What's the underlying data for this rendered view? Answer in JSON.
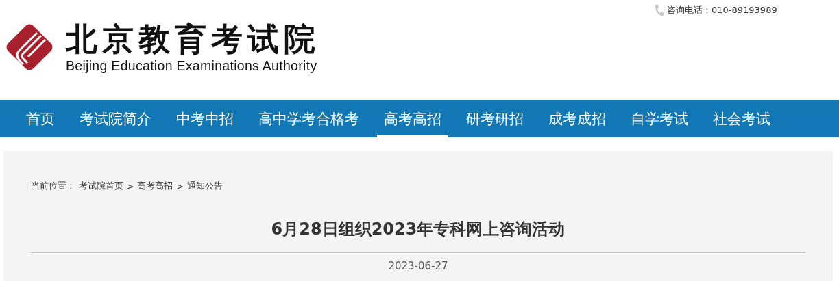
{
  "header": {
    "phone": "咨询电话：010-89193989",
    "logo_cn": "北京教育考试院",
    "logo_en": "Beijing Education Examinations Authority"
  },
  "nav": [
    {
      "label": "首页",
      "selected": false
    },
    {
      "label": "考试院简介",
      "selected": false
    },
    {
      "label": "中考中招",
      "selected": false
    },
    {
      "label": "高中学考合格考",
      "selected": false
    },
    {
      "label": "高考高招",
      "selected": true
    },
    {
      "label": "研考研招",
      "selected": false
    },
    {
      "label": "成考成招",
      "selected": false
    },
    {
      "label": "自学考试",
      "selected": false
    },
    {
      "label": "社会考试",
      "selected": false
    }
  ],
  "breadcrumb": {
    "label": "当前位置：",
    "links": [
      "考试院首页",
      "高考高招",
      "通知公告"
    ],
    "separators": [
      ">",
      ">"
    ]
  },
  "article": {
    "title": "6月28日组织2023年专科网上咨询活动",
    "date": "2023-06-27"
  }
}
